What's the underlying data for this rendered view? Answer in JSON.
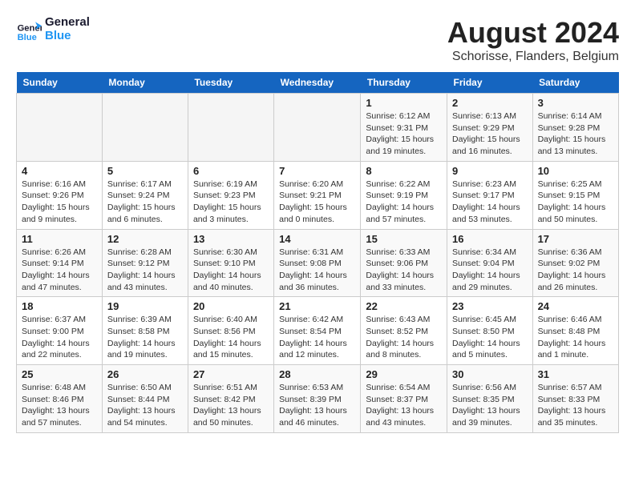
{
  "logo": {
    "line1": "General",
    "line2": "Blue"
  },
  "title": "August 2024",
  "location": "Schorisse, Flanders, Belgium",
  "days_of_week": [
    "Sunday",
    "Monday",
    "Tuesday",
    "Wednesday",
    "Thursday",
    "Friday",
    "Saturday"
  ],
  "weeks": [
    [
      {
        "num": "",
        "info": ""
      },
      {
        "num": "",
        "info": ""
      },
      {
        "num": "",
        "info": ""
      },
      {
        "num": "",
        "info": ""
      },
      {
        "num": "1",
        "info": "Sunrise: 6:12 AM\nSunset: 9:31 PM\nDaylight: 15 hours\nand 19 minutes."
      },
      {
        "num": "2",
        "info": "Sunrise: 6:13 AM\nSunset: 9:29 PM\nDaylight: 15 hours\nand 16 minutes."
      },
      {
        "num": "3",
        "info": "Sunrise: 6:14 AM\nSunset: 9:28 PM\nDaylight: 15 hours\nand 13 minutes."
      }
    ],
    [
      {
        "num": "4",
        "info": "Sunrise: 6:16 AM\nSunset: 9:26 PM\nDaylight: 15 hours\nand 9 minutes."
      },
      {
        "num": "5",
        "info": "Sunrise: 6:17 AM\nSunset: 9:24 PM\nDaylight: 15 hours\nand 6 minutes."
      },
      {
        "num": "6",
        "info": "Sunrise: 6:19 AM\nSunset: 9:23 PM\nDaylight: 15 hours\nand 3 minutes."
      },
      {
        "num": "7",
        "info": "Sunrise: 6:20 AM\nSunset: 9:21 PM\nDaylight: 15 hours\nand 0 minutes."
      },
      {
        "num": "8",
        "info": "Sunrise: 6:22 AM\nSunset: 9:19 PM\nDaylight: 14 hours\nand 57 minutes."
      },
      {
        "num": "9",
        "info": "Sunrise: 6:23 AM\nSunset: 9:17 PM\nDaylight: 14 hours\nand 53 minutes."
      },
      {
        "num": "10",
        "info": "Sunrise: 6:25 AM\nSunset: 9:15 PM\nDaylight: 14 hours\nand 50 minutes."
      }
    ],
    [
      {
        "num": "11",
        "info": "Sunrise: 6:26 AM\nSunset: 9:14 PM\nDaylight: 14 hours\nand 47 minutes."
      },
      {
        "num": "12",
        "info": "Sunrise: 6:28 AM\nSunset: 9:12 PM\nDaylight: 14 hours\nand 43 minutes."
      },
      {
        "num": "13",
        "info": "Sunrise: 6:30 AM\nSunset: 9:10 PM\nDaylight: 14 hours\nand 40 minutes."
      },
      {
        "num": "14",
        "info": "Sunrise: 6:31 AM\nSunset: 9:08 PM\nDaylight: 14 hours\nand 36 minutes."
      },
      {
        "num": "15",
        "info": "Sunrise: 6:33 AM\nSunset: 9:06 PM\nDaylight: 14 hours\nand 33 minutes."
      },
      {
        "num": "16",
        "info": "Sunrise: 6:34 AM\nSunset: 9:04 PM\nDaylight: 14 hours\nand 29 minutes."
      },
      {
        "num": "17",
        "info": "Sunrise: 6:36 AM\nSunset: 9:02 PM\nDaylight: 14 hours\nand 26 minutes."
      }
    ],
    [
      {
        "num": "18",
        "info": "Sunrise: 6:37 AM\nSunset: 9:00 PM\nDaylight: 14 hours\nand 22 minutes."
      },
      {
        "num": "19",
        "info": "Sunrise: 6:39 AM\nSunset: 8:58 PM\nDaylight: 14 hours\nand 19 minutes."
      },
      {
        "num": "20",
        "info": "Sunrise: 6:40 AM\nSunset: 8:56 PM\nDaylight: 14 hours\nand 15 minutes."
      },
      {
        "num": "21",
        "info": "Sunrise: 6:42 AM\nSunset: 8:54 PM\nDaylight: 14 hours\nand 12 minutes."
      },
      {
        "num": "22",
        "info": "Sunrise: 6:43 AM\nSunset: 8:52 PM\nDaylight: 14 hours\nand 8 minutes."
      },
      {
        "num": "23",
        "info": "Sunrise: 6:45 AM\nSunset: 8:50 PM\nDaylight: 14 hours\nand 5 minutes."
      },
      {
        "num": "24",
        "info": "Sunrise: 6:46 AM\nSunset: 8:48 PM\nDaylight: 14 hours\nand 1 minute."
      }
    ],
    [
      {
        "num": "25",
        "info": "Sunrise: 6:48 AM\nSunset: 8:46 PM\nDaylight: 13 hours\nand 57 minutes."
      },
      {
        "num": "26",
        "info": "Sunrise: 6:50 AM\nSunset: 8:44 PM\nDaylight: 13 hours\nand 54 minutes."
      },
      {
        "num": "27",
        "info": "Sunrise: 6:51 AM\nSunset: 8:42 PM\nDaylight: 13 hours\nand 50 minutes."
      },
      {
        "num": "28",
        "info": "Sunrise: 6:53 AM\nSunset: 8:39 PM\nDaylight: 13 hours\nand 46 minutes."
      },
      {
        "num": "29",
        "info": "Sunrise: 6:54 AM\nSunset: 8:37 PM\nDaylight: 13 hours\nand 43 minutes."
      },
      {
        "num": "30",
        "info": "Sunrise: 6:56 AM\nSunset: 8:35 PM\nDaylight: 13 hours\nand 39 minutes."
      },
      {
        "num": "31",
        "info": "Sunrise: 6:57 AM\nSunset: 8:33 PM\nDaylight: 13 hours\nand 35 minutes."
      }
    ]
  ]
}
